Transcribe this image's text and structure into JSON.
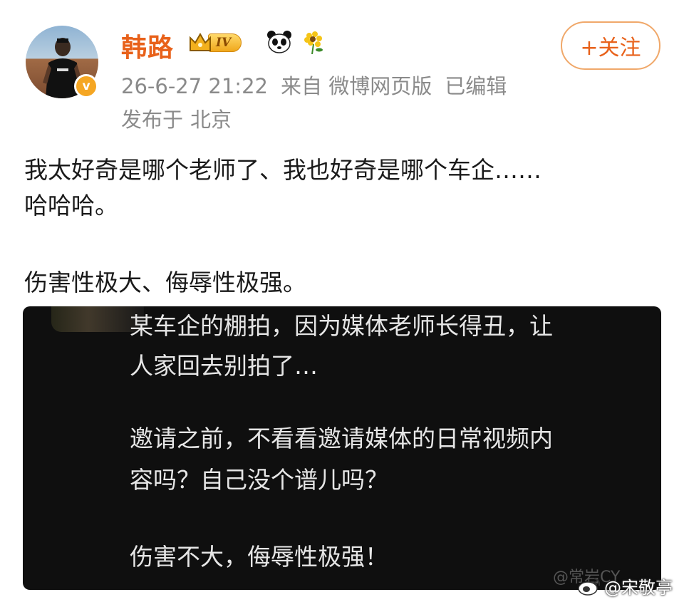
{
  "post": {
    "username": "韩路",
    "level_label": "IV",
    "timestamp": "26-6-27 21:22",
    "source": "来自 微博网页版",
    "edited": "已编辑",
    "location_prefix": "发布于",
    "location": "北京",
    "follow_label": "+关注",
    "verified_glyph": "v",
    "text_lines": [
      "我太好奇是哪个老师了、我也好奇是哪个车企……",
      "哈哈哈。",
      "伤害性极大、侮辱性极强。"
    ]
  },
  "embedded_image": {
    "lines": [
      "某车企的棚拍，因为媒体老师长得丑，让",
      "人家回去别拍了…",
      "邀请之前，不看看邀请媒体的日常视频内",
      "容吗？自己没个谱儿吗？",
      "伤害不大，侮辱性极强！"
    ],
    "watermark_1": "@常岩CY",
    "watermark_2": "@宋敬亭"
  },
  "icons": {
    "avatar": "profile-photo",
    "verified": "verified-badge-icon",
    "crown": "crown-icon",
    "panda": "panda-icon",
    "sunflower": "sunflower-icon",
    "weibo": "weibo-logo-icon"
  },
  "colors": {
    "username": "#e8611a",
    "follow_border": "#f0a86a",
    "meta_gray": "#8a8a8a",
    "embed_bg": "#0f0f0f"
  }
}
